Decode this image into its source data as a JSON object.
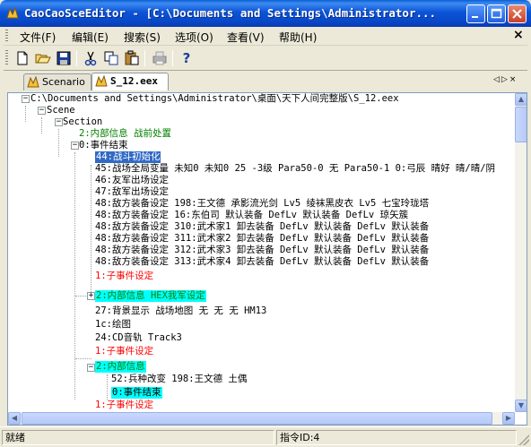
{
  "window": {
    "title": "CaoCaoSceEditor - [C:\\Documents and Settings\\Administrator...",
    "title_color": "#ffffff",
    "titlebar_color": "#0b54d8"
  },
  "menu": {
    "items": [
      "文件(F)",
      "编辑(E)",
      "搜索(S)",
      "选项(O)",
      "查看(V)",
      "帮助(H)"
    ],
    "mdi_close": "×"
  },
  "toolbar": {
    "tools": [
      "new-icon",
      "open-icon",
      "save-icon",
      "cut-icon",
      "copy-icon",
      "paste-icon",
      "print-icon",
      "help-icon"
    ],
    "help_glyph": "?"
  },
  "tabs": [
    {
      "label": "Scenario",
      "icon": "cao-cao-icon",
      "active": false
    },
    {
      "label": "S_12.eex",
      "icon": "cao-cao-icon",
      "active": true
    }
  ],
  "tab_nav": "◁▷×",
  "tree": {
    "nodes": [
      {
        "text": "C:\\Documents and Settings\\Administrator\\桌面\\天下人间完整版\\S_12.eex",
        "color": "#000000",
        "bg": ""
      },
      {
        "text": "Scene",
        "color": "#000000",
        "bg": ""
      },
      {
        "text": "Section",
        "color": "#000000",
        "bg": ""
      },
      {
        "text": "2:内部信息 战前处置",
        "color": "#008000",
        "bg": ""
      },
      {
        "text": "0:事件结束",
        "color": "#000000",
        "bg": ""
      },
      {
        "text": "44:战斗初始化",
        "color": "#ffffff",
        "bg": "#316ac5"
      },
      {
        "text": "45:战场全局变量 未知0 未知0 25 -3级 Para50-0 无 Para50-1 0:弓辰 晴好 晴/晴/阴",
        "color": "#000000",
        "bg": ""
      },
      {
        "text": "46:友军出场设定",
        "color": "#000000",
        "bg": ""
      },
      {
        "text": "47:敌军出场设定",
        "color": "#000000",
        "bg": ""
      },
      {
        "text": "48:敌方装备设定 198:王文德 承影流光剑 Lv5 绫袜黑皮衣 Lv5 七宝玲珑塔",
        "color": "#000000",
        "bg": ""
      },
      {
        "text": "48:敌方装备设定 16:东伯司 默认装备 DefLv 默认装备 DefLv 琼矢簇",
        "color": "#000000",
        "bg": ""
      },
      {
        "text": "48:敌方装备设定 310:武术家1 卸去装备 DefLv 默认装备 DefLv 默认装备",
        "color": "#000000",
        "bg": ""
      },
      {
        "text": "48:敌方装备设定 311:武术家2 卸去装备 DefLv 默认装备 DefLv 默认装备",
        "color": "#000000",
        "bg": ""
      },
      {
        "text": "48:敌方装备设定 312:武术家3 卸去装备 DefLv 默认装备 DefLv 默认装备",
        "color": "#000000",
        "bg": ""
      },
      {
        "text": "48:敌方装备设定 313:武术家4 卸去装备 DefLv 默认装备 DefLv 默认装备",
        "color": "#000000",
        "bg": ""
      },
      {
        "text": "1:子事件设定",
        "color": "#ff0000",
        "bg": ""
      },
      {
        "text": "2:内部信息 HEX我军设定",
        "color": "#008000",
        "bg": "#00ffff"
      },
      {
        "text": "27:背景显示 战场地图 无 无 无 HM13",
        "color": "#000000",
        "bg": ""
      },
      {
        "text": "1c:绘图",
        "color": "#000000",
        "bg": ""
      },
      {
        "text": "24:CD音轨 Track3",
        "color": "#000000",
        "bg": ""
      },
      {
        "text": "1:子事件设定",
        "color": "#ff0000",
        "bg": ""
      },
      {
        "text": "2:内部信息",
        "color": "#008000",
        "bg": "#00ffff"
      },
      {
        "text": "52:兵种改变 198:王文德 土偶",
        "color": "#000000",
        "bg": ""
      },
      {
        "text": "0:事件结束",
        "color": "#000000",
        "bg": "#00ffff"
      },
      {
        "text": "1:子事件设定",
        "color": "#ff0000",
        "bg": ""
      }
    ]
  },
  "status": {
    "left": "就绪",
    "middle": "指令ID:4"
  }
}
